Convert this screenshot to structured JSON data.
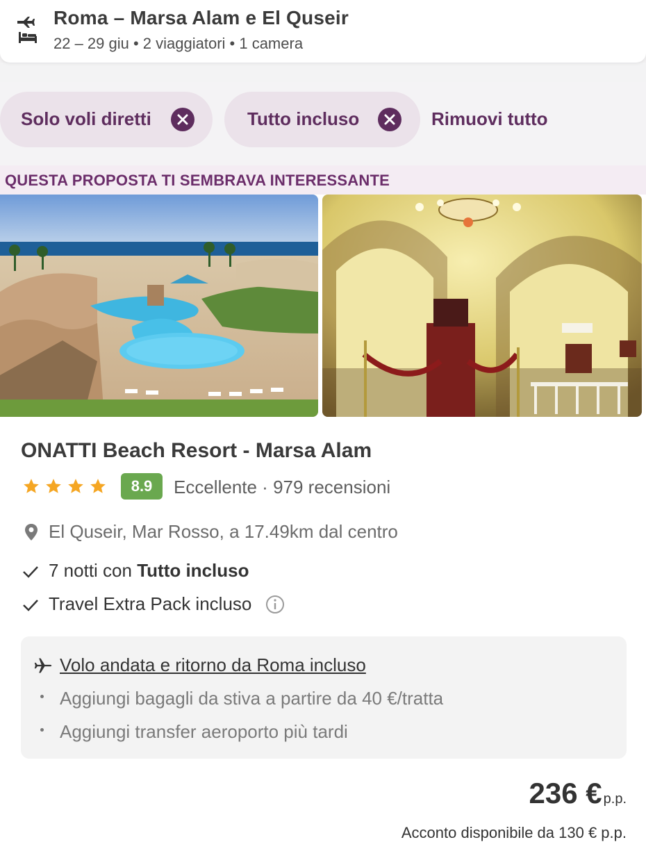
{
  "header": {
    "title": "Roma – Marsa Alam e El Quseir",
    "subtitle": "22 – 29 giu • 2 viaggiatori • 1 camera",
    "icon": "flight-hotel-icon"
  },
  "filters": {
    "chips": [
      {
        "label": "Solo voli diretti",
        "icon": "close-circle-icon"
      },
      {
        "label": "Tutto incluso",
        "icon": "close-circle-icon"
      }
    ],
    "remove_all": "Rimuovi tutto"
  },
  "banner": {
    "text": "QUESTA PROPOSTA TI SEMBRAVA INTERESSANTE"
  },
  "hotel": {
    "name": "ONATTI Beach Resort - Marsa Alam",
    "stars": 4,
    "score": "8.9",
    "score_text": "Eccellente · 979 recensioni",
    "location": "El Quseir, Mar Rosso, a 17.49km dal centro",
    "features": {
      "nights_prefix": "7 notti con ",
      "nights_board": "Tutto incluso",
      "extra_pack": "Travel Extra Pack incluso"
    }
  },
  "flight": {
    "title": "Volo andata e ritorno da Roma incluso",
    "items": [
      "Aggiungi bagagli da stiva a partire da 40 €/tratta",
      "Aggiungi transfer aeroporto più tardi"
    ]
  },
  "price": {
    "amount": "236 €",
    "unit": "p.p.",
    "deposit": "Acconto disponibile da 130 € p.p."
  },
  "colors": {
    "brand_purple": "#5e2d5e",
    "score_green": "#6aa84f",
    "star_orange": "#f5a623"
  }
}
